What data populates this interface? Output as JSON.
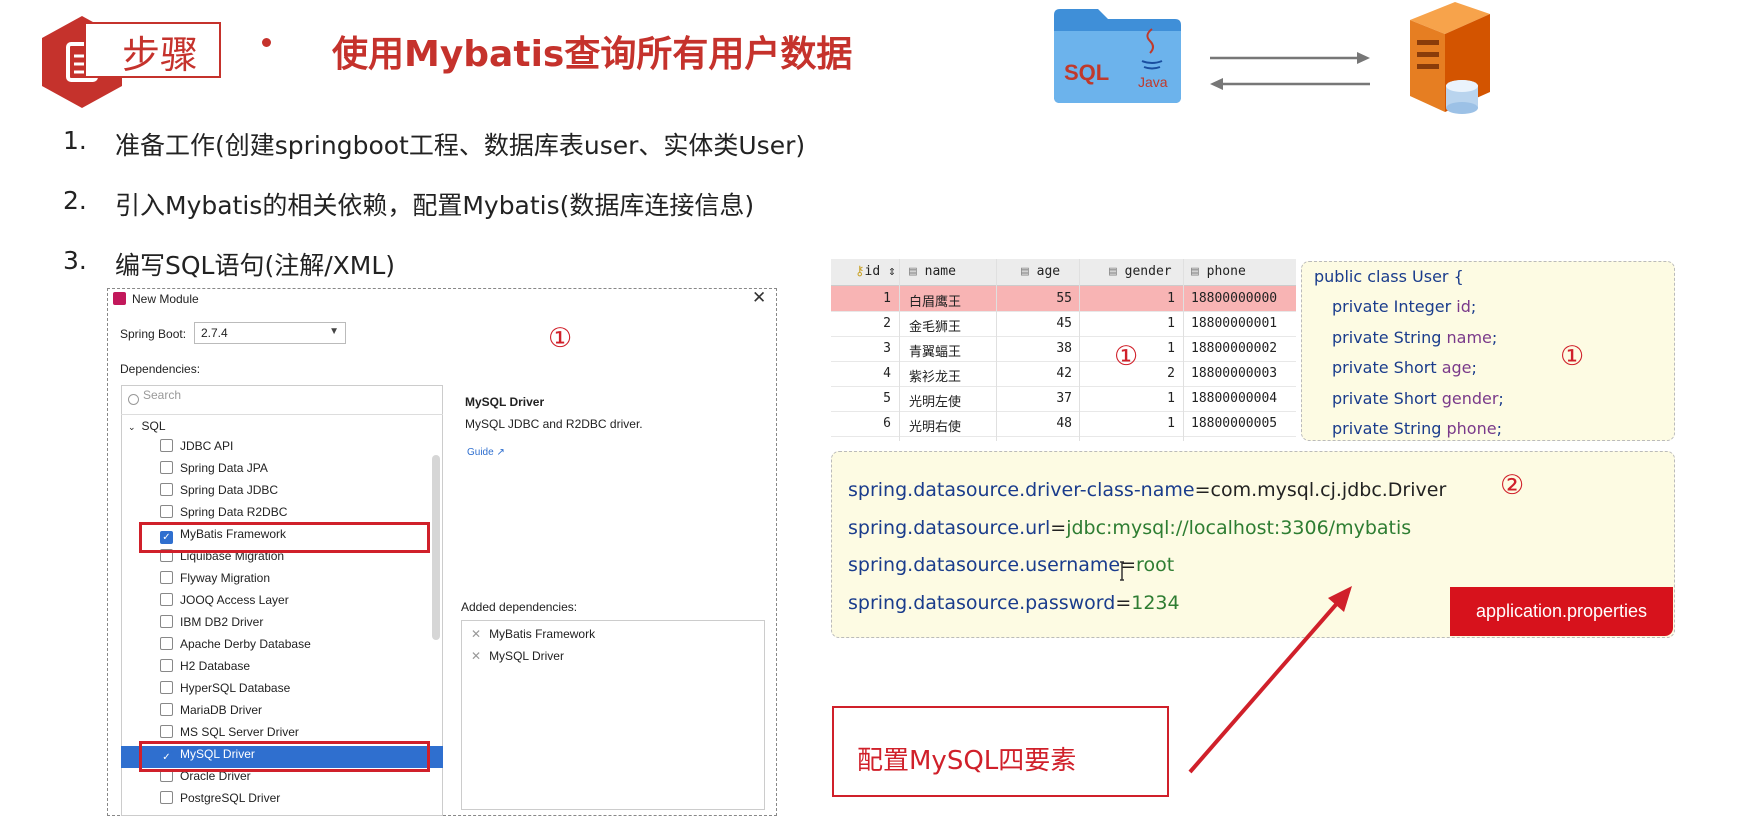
{
  "header": {
    "step_label": "步骤",
    "title": "使用Mybatis查询所有用户数据",
    "sql_label": "SQL",
    "java_label": "Java"
  },
  "steps": [
    {
      "num": "1.",
      "text": "准备工作(创建springboot工程、数据库表user、实体类User)"
    },
    {
      "num": "2.",
      "text": "引入Mybatis的相关依赖，配置Mybatis(数据库连接信息)"
    },
    {
      "num": "3.",
      "text": "编写SQL语句(注解/XML)"
    }
  ],
  "dialog": {
    "title": "New Module",
    "spring_boot_label": "Spring Boot:",
    "spring_boot_value": "2.7.4",
    "dependencies_label": "Dependencies:",
    "search_placeholder": "Search",
    "category": "SQL",
    "items": [
      {
        "label": "JDBC API",
        "checked": false
      },
      {
        "label": "Spring Data JPA",
        "checked": false
      },
      {
        "label": "Spring Data JDBC",
        "checked": false
      },
      {
        "label": "Spring Data R2DBC",
        "checked": false
      },
      {
        "label": "MyBatis Framework",
        "checked": true
      },
      {
        "label": "Liquibase Migration",
        "checked": false
      },
      {
        "label": "Flyway Migration",
        "checked": false
      },
      {
        "label": "JOOQ Access Layer",
        "checked": false
      },
      {
        "label": "IBM DB2 Driver",
        "checked": false
      },
      {
        "label": "Apache Derby Database",
        "checked": false
      },
      {
        "label": "H2 Database",
        "checked": false
      },
      {
        "label": "HyperSQL Database",
        "checked": false
      },
      {
        "label": "MariaDB Driver",
        "checked": false
      },
      {
        "label": "MS SQL Server Driver",
        "checked": false
      },
      {
        "label": "MySQL Driver",
        "checked": true
      },
      {
        "label": "Oracle Driver",
        "checked": false
      },
      {
        "label": "PostgreSQL Driver",
        "checked": false
      }
    ],
    "detail_title": "MySQL Driver",
    "detail_desc": "MySQL JDBC and R2DBC driver.",
    "guide_link": "Guide ↗",
    "added_label": "Added dependencies:",
    "added": [
      "MyBatis Framework",
      "MySQL Driver"
    ]
  },
  "markers": {
    "one": "①",
    "two": "②"
  },
  "table": {
    "columns": [
      "id",
      "name",
      "age",
      "gender",
      "phone"
    ],
    "rows": [
      [
        "1",
        "白眉鹰王",
        "55",
        "1",
        "18800000000"
      ],
      [
        "2",
        "金毛狮王",
        "45",
        "1",
        "18800000001"
      ],
      [
        "3",
        "青翼蝠王",
        "38",
        "1",
        "18800000002"
      ],
      [
        "4",
        "紫衫龙王",
        "42",
        "2",
        "18800000003"
      ],
      [
        "5",
        "光明左使",
        "37",
        "1",
        "18800000004"
      ],
      [
        "6",
        "光明右使",
        "48",
        "1",
        "18800000005"
      ]
    ]
  },
  "entity": {
    "decl": "public class User {",
    "fields": [
      {
        "prefix": "private Integer ",
        "name": "id",
        "suffix": ";"
      },
      {
        "prefix": "private String ",
        "name": "name",
        "suffix": ";"
      },
      {
        "prefix": "private Short ",
        "name": "age",
        "suffix": ";"
      },
      {
        "prefix": "private Short ",
        "name": "gender",
        "suffix": ";"
      },
      {
        "prefix": "private String ",
        "name": "phone",
        "suffix": ";"
      }
    ]
  },
  "properties": [
    {
      "key": "spring.datasource.driver-class-name",
      "eq": "=",
      "value": "com.mysql.cj.jdbc.Driver"
    },
    {
      "key": "spring.datasource.url",
      "eq": "=",
      "value": "jdbc:mysql://localhost:3306/mybatis"
    },
    {
      "key": "spring.datasource.username",
      "eq": "=",
      "value": "root"
    },
    {
      "key": "spring.datasource.password",
      "eq": "=",
      "value": "1234"
    }
  ],
  "properties_file": "application.properties",
  "note": "配置MySQL四要素",
  "colors": {
    "accent": "#c5322c",
    "red": "#d0202a",
    "selection_blue": "#2f6fcf",
    "code_bg": "#fdfbe3"
  }
}
